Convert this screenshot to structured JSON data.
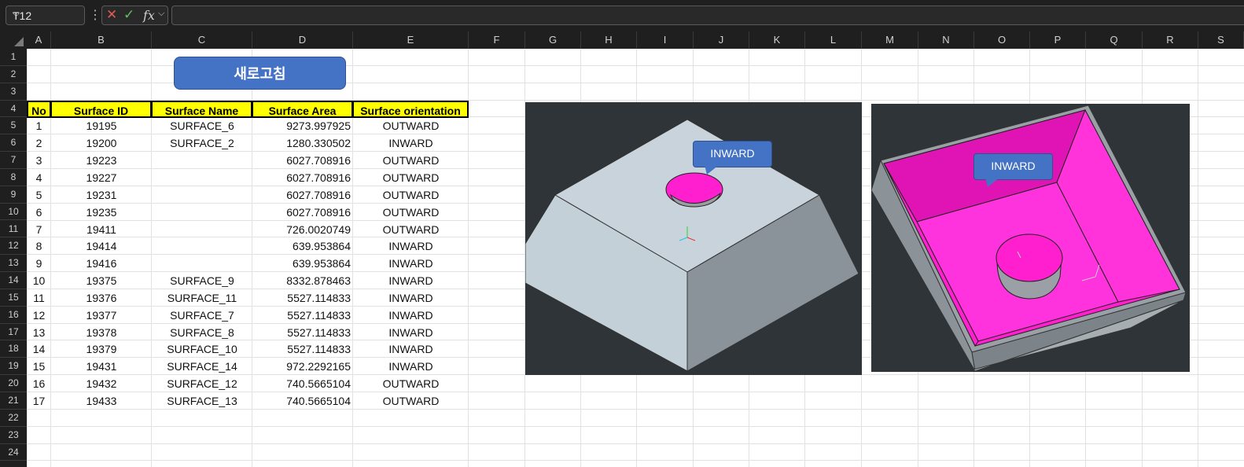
{
  "formula_bar": {
    "name_box": "T12",
    "cancel_icon": "cancel-icon",
    "enter_icon": "check-icon",
    "fx_label": "fx",
    "formula": ""
  },
  "columns": [
    "A",
    "B",
    "C",
    "D",
    "E",
    "F",
    "G",
    "H",
    "I",
    "J",
    "K",
    "L",
    "M",
    "N",
    "O",
    "P",
    "Q",
    "R",
    "S"
  ],
  "rows": [
    "1",
    "2",
    "3",
    "4",
    "5",
    "6",
    "7",
    "8",
    "9",
    "10",
    "11",
    "12",
    "13",
    "14",
    "15",
    "16",
    "17",
    "18",
    "19",
    "20",
    "21",
    "22",
    "23",
    "24"
  ],
  "refresh_button": "새로고침",
  "table": {
    "headers": [
      "No",
      "Surface ID",
      "Surface Name",
      "Surface Area",
      "Surface orientation"
    ],
    "rows": [
      [
        "1",
        "19195",
        "SURFACE_6",
        "9273.997925",
        "OUTWARD"
      ],
      [
        "2",
        "19200",
        "SURFACE_2",
        "1280.330502",
        "INWARD"
      ],
      [
        "3",
        "19223",
        "",
        "6027.708916",
        "OUTWARD"
      ],
      [
        "4",
        "19227",
        "",
        "6027.708916",
        "OUTWARD"
      ],
      [
        "5",
        "19231",
        "",
        "6027.708916",
        "OUTWARD"
      ],
      [
        "6",
        "19235",
        "",
        "6027.708916",
        "OUTWARD"
      ],
      [
        "7",
        "19411",
        "",
        "726.0020749",
        "OUTWARD"
      ],
      [
        "8",
        "19414",
        "",
        "639.953864",
        "INWARD"
      ],
      [
        "9",
        "19416",
        "",
        "639.953864",
        "INWARD"
      ],
      [
        "10",
        "19375",
        "SURFACE_9",
        "8332.878463",
        "INWARD"
      ],
      [
        "11",
        "19376",
        "SURFACE_11",
        "5527.114833",
        "INWARD"
      ],
      [
        "12",
        "19377",
        "SURFACE_7",
        "5527.114833",
        "INWARD"
      ],
      [
        "13",
        "19378",
        "SURFACE_8",
        "5527.114833",
        "INWARD"
      ],
      [
        "14",
        "19379",
        "SURFACE_10",
        "5527.114833",
        "INWARD"
      ],
      [
        "15",
        "19431",
        "SURFACE_14",
        "972.2292165",
        "INWARD"
      ],
      [
        "16",
        "19432",
        "SURFACE_12",
        "740.5665104",
        "OUTWARD"
      ],
      [
        "17",
        "19433",
        "SURFACE_13",
        "740.5665104",
        "OUTWARD"
      ]
    ]
  },
  "image1": {
    "callout": "INWARD"
  },
  "image2": {
    "callout": "INWARD"
  },
  "colors": {
    "accent": "#4472c4",
    "header_fill": "#ffff00",
    "magenta": "#ff00ff"
  }
}
